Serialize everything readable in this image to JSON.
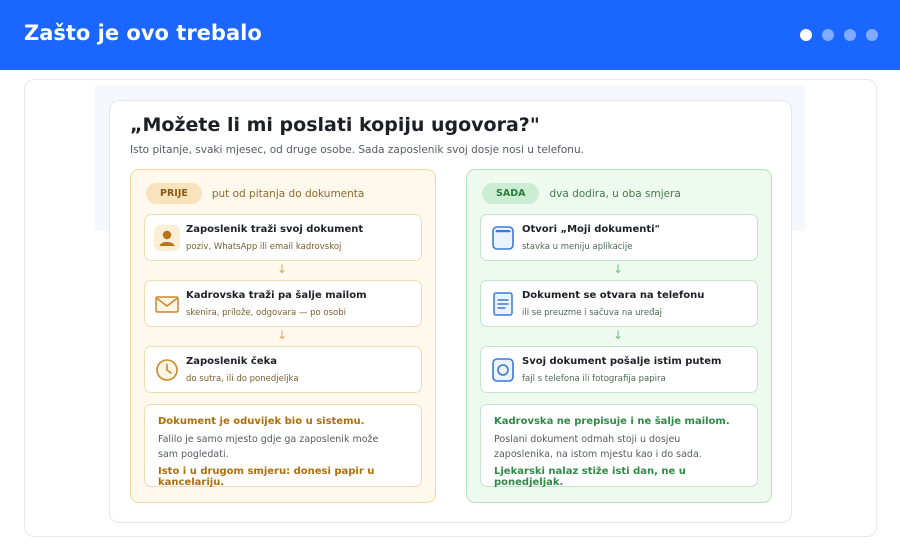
{
  "header": {
    "title": "Zašto je ovo trebalo",
    "pager": {
      "count": 4,
      "active": 0
    }
  },
  "card": {
    "title": "„Možete li mi poslati kopiju ugovora?\"",
    "subtitle": "Isto pitanje, svaki mjesec, od druge osobe. Sada zaposlenik svoj dosje nosi u telefonu."
  },
  "before": {
    "badge": "PRIJE",
    "caption": "put od pitanja do dokumenta",
    "steps": [
      {
        "icon": "person-icon",
        "title": "Zaposlenik traži svoj dokument",
        "sub": "poziv, WhatsApp ili email kadrovskoj"
      },
      {
        "icon": "envelope-icon",
        "title": "Kadrovska traži pa šalje mailom",
        "sub": "skenira, prilože, odgovara — po osobi"
      },
      {
        "icon": "clock-icon",
        "title": "Zaposlenik čeka",
        "sub": "do sutra, ili do ponedjeljka"
      }
    ],
    "summary": {
      "head": "Dokument je oduvijek bio u sistemu.",
      "body": "Falilo je samo mjesto gdje ga zaposlenik može sam pogledati.",
      "foot": "Isto i u drugom smjeru: donesi papir u kancelariju."
    }
  },
  "after": {
    "badge": "SADA",
    "caption": "dva dodira, u oba smjera",
    "steps": [
      {
        "icon": "phone-icon",
        "title": "Otvori „Moji dokumenti\"",
        "sub": "stavka u meniju aplikacije"
      },
      {
        "icon": "document-icon",
        "title": "Dokument se otvara na telefonu",
        "sub": "ili se preuzme i sačuva na uređaj"
      },
      {
        "icon": "camera-icon",
        "title": "Svoj dokument pošalje istim putem",
        "sub": "fajl s telefona ili fotografija papira"
      }
    ],
    "summary": {
      "head": "Kadrovska ne prepisuje i ne šalje mailom.",
      "body": "Poslani dokument odmah stoji u dosjeu zaposlenika, na istom mjestu kao i do sada.",
      "foot": "Ljekarski nalaz stiže isti dan, ne u ponedjeljak."
    }
  },
  "arrow_glyph": "↓",
  "colors": {
    "brand": "#1a66ff",
    "before_accent": "#b06d08",
    "after_accent": "#2f8a45"
  }
}
